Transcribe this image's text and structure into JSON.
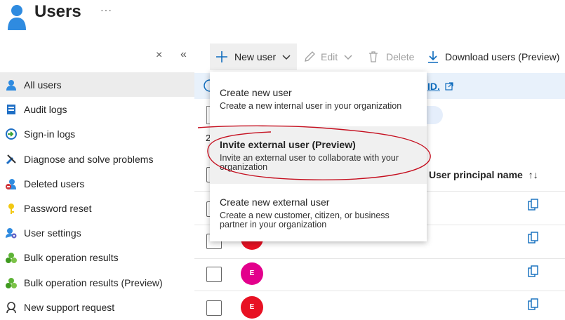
{
  "header": {
    "title": "Users",
    "more": "···"
  },
  "sidebar": {
    "close_glyph": "×",
    "collapse_glyph": "«",
    "items": [
      {
        "label": "All users",
        "icon": "user-icon"
      },
      {
        "label": "Audit logs",
        "icon": "audit-log-icon"
      },
      {
        "label": "Sign-in logs",
        "icon": "sign-in-icon"
      },
      {
        "label": "Diagnose and solve problems",
        "icon": "wrench-icon"
      },
      {
        "label": "Deleted users",
        "icon": "deleted-user-icon"
      },
      {
        "label": "Password reset",
        "icon": "key-icon"
      },
      {
        "label": "User settings",
        "icon": "user-settings-icon"
      },
      {
        "label": "Bulk operation results",
        "icon": "bulk-icon"
      },
      {
        "label": "Bulk operation results (Preview)",
        "icon": "bulk-icon"
      },
      {
        "label": "New support request",
        "icon": "support-icon"
      }
    ]
  },
  "toolbar": {
    "new_user": "New user",
    "edit": "Edit",
    "delete": "Delete",
    "download": "Download users (Preview)"
  },
  "menu": {
    "items": [
      {
        "title": "Create new user",
        "desc": "Create a new internal user in your organization"
      },
      {
        "title": "Invite external user (Preview)",
        "desc": "Invite an external user to collaborate with your organization"
      },
      {
        "title": "Create new external user",
        "desc": "Create a new customer, citizen, or business partner in your organization"
      }
    ]
  },
  "banner": {
    "link_text": "ID."
  },
  "table": {
    "count_fragment": "2",
    "column_upn": "User principal name",
    "sort_glyph": "↑↓",
    "avatars": [
      {
        "initial": "E",
        "color": "#e3008c"
      },
      {
        "initial": "E",
        "color": "#e81123"
      }
    ]
  },
  "colors": {
    "accent": "#0f6cbd",
    "annotation": "#c50f1f"
  }
}
